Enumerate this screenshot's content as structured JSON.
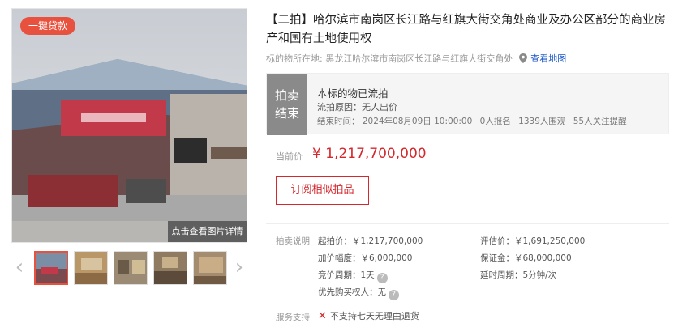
{
  "gallery": {
    "badge": "一键贷款",
    "detail_button": "点击查看图片详情",
    "thumb_count": 5,
    "active_thumb": 1
  },
  "header": {
    "title": "【二拍】哈尔滨市南岗区长江路与红旗大街交角处商业及办公区部分的商业房产和国有土地使用权",
    "location_label": "标的物所在地:",
    "location_value": "黑龙江哈尔滨市南岗区长江路与红旗大街交角处",
    "map_link": "查看地图"
  },
  "status": {
    "tag_line1": "拍卖",
    "tag_line2": "结束",
    "title": "本标的物已流拍",
    "reason": "流拍原因：无人出价",
    "end_label": "结束时间：",
    "end_time": "2024年08月09日 10:00:00",
    "signups": "0人报名",
    "views": "1339人围观",
    "reminders": "55人关注提醒"
  },
  "price": {
    "label": "当前价",
    "value": "¥ 1,217,700,000",
    "subscribe_button": "订阅相似拍品"
  },
  "auction_info": {
    "label": "拍卖说明",
    "start_price": "起拍价：￥1,217,700,000",
    "appraisal": "评估价：￥1,691,250,000",
    "increment": "加价幅度：￥6,000,000",
    "deposit": "保证金：￥68,000,000",
    "bid_period": "竞价周期：1天",
    "delay_period": "延时周期：5分钟/次",
    "priority": "优先购买权人：无"
  },
  "service": {
    "label": "服务支持",
    "item": "不支持七天无理由退货"
  },
  "colors": {
    "accent_red": "#d4282d",
    "badge_red": "#e8513d",
    "status_gray": "#8a8a8a",
    "link_blue": "#1a56c7"
  }
}
